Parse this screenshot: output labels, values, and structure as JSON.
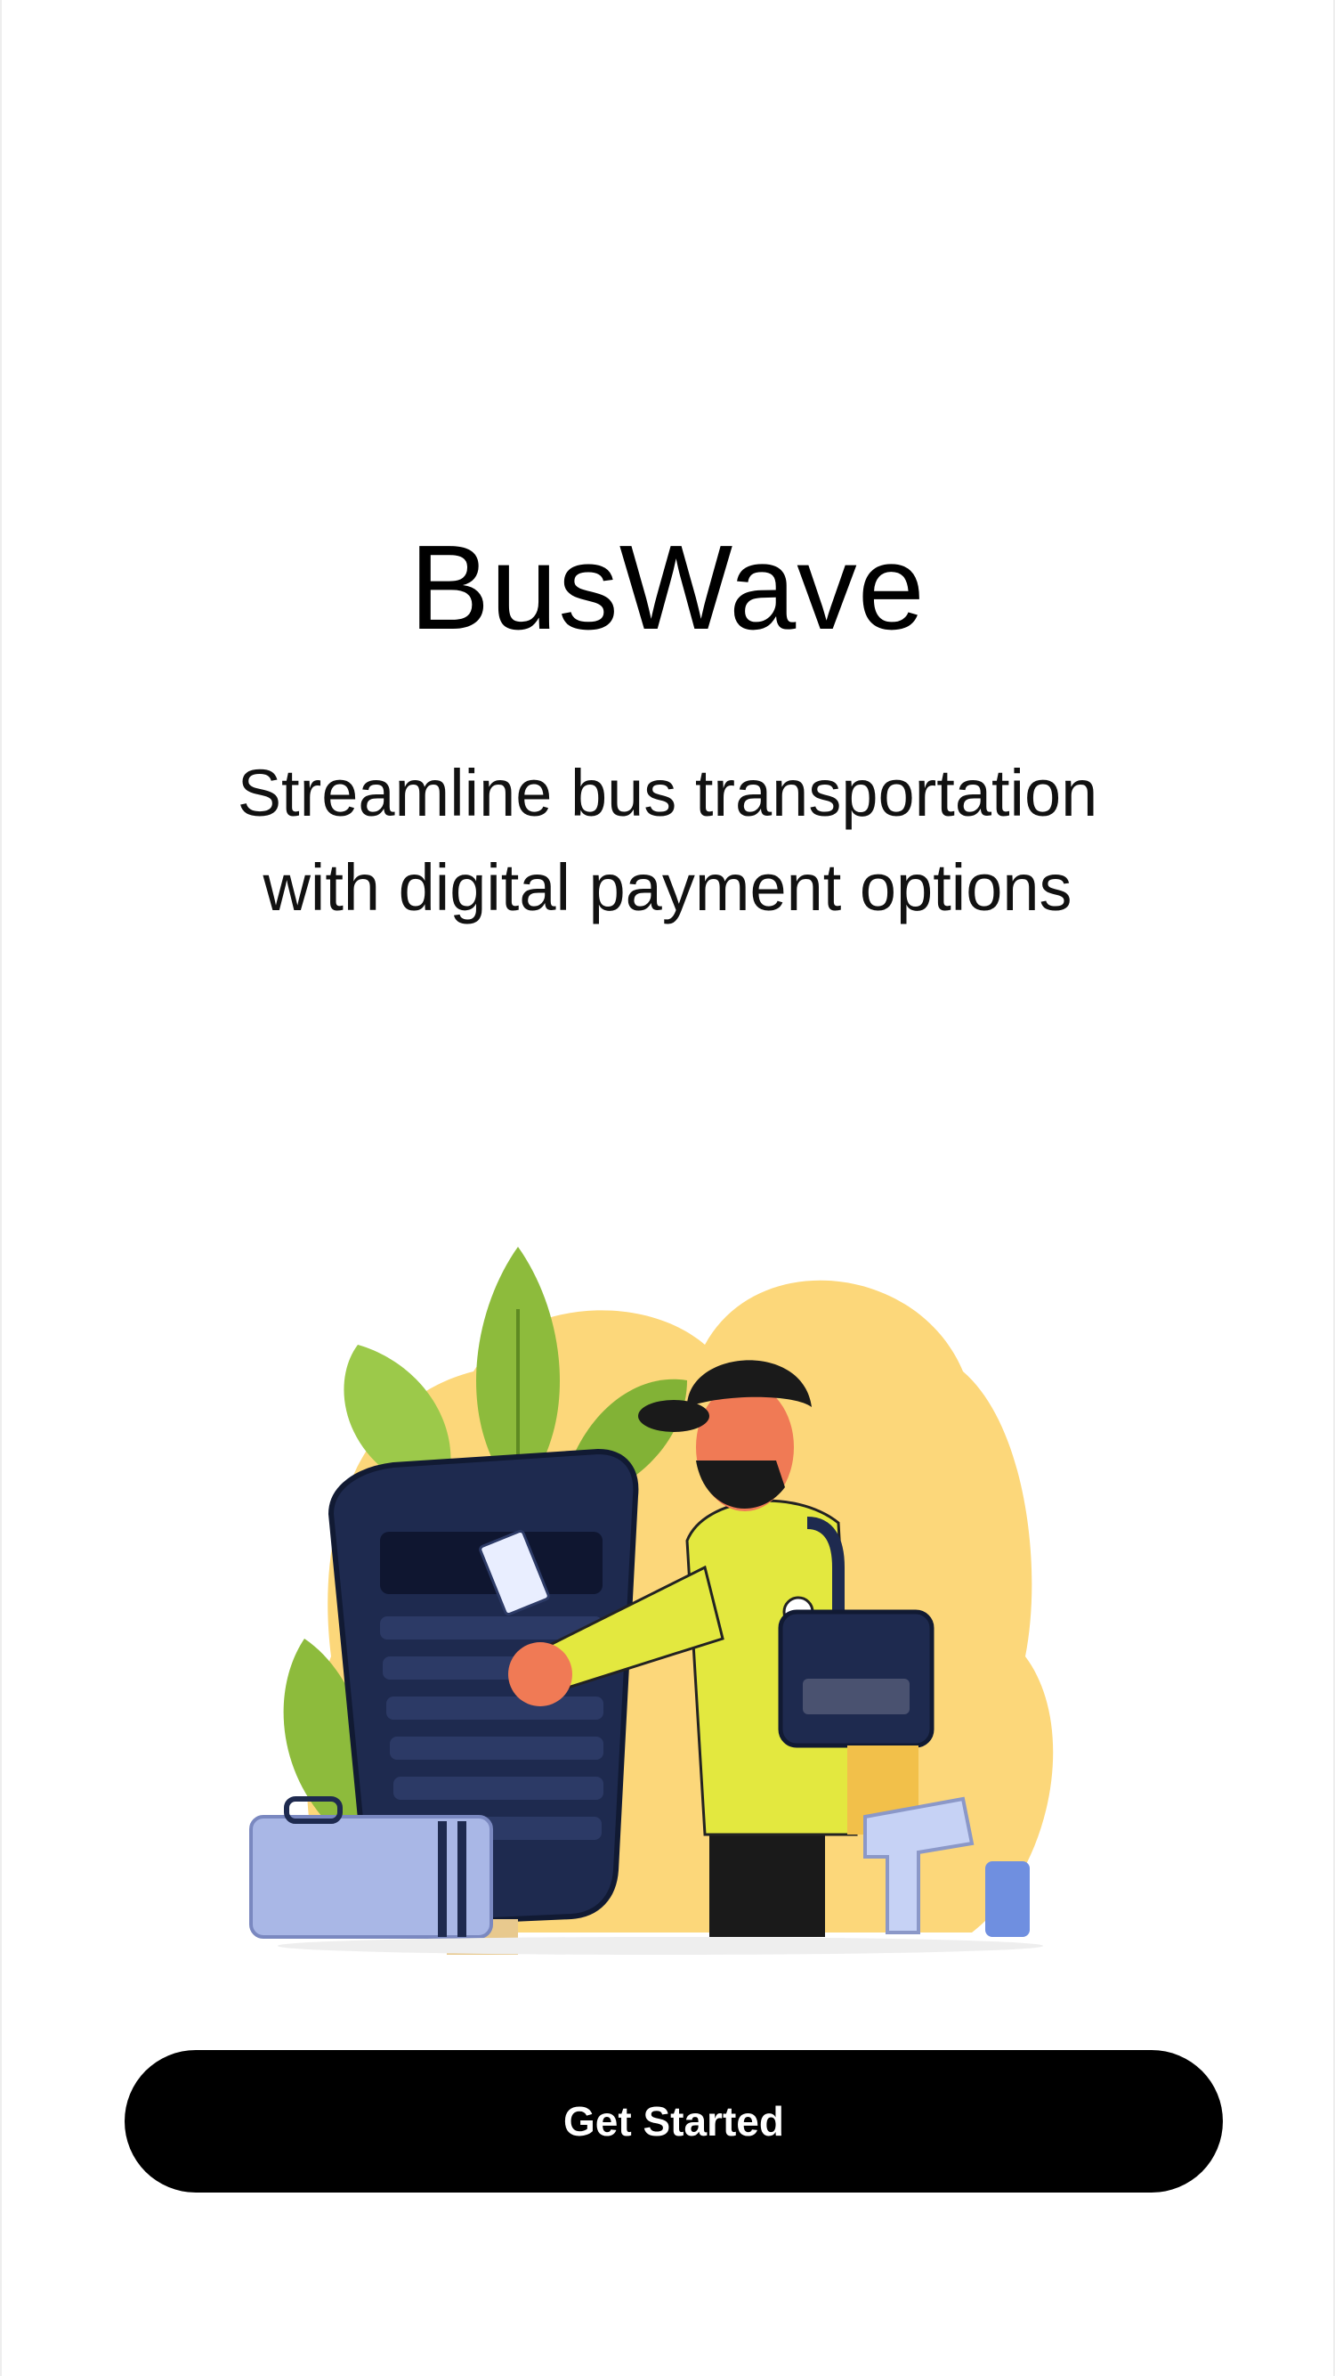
{
  "app": {
    "title": "BusWave",
    "tagline_line1": "Streamline bus transportation",
    "tagline_line2": "with digital payment options"
  },
  "illustration": {
    "icon": "bus-fare-payment-illustration",
    "colors": {
      "background_blob": "#FCD77A",
      "terminal": "#1E2A4F",
      "shirt": "#E3E83F",
      "skin": "#F07A55",
      "leaves": "#8DBB3C",
      "luggage": "#A9B7E6"
    }
  },
  "actions": {
    "get_started_label": "Get Started"
  },
  "theme": {
    "background": "#FFFFFF",
    "button_bg": "#000000",
    "button_text": "#FFFFFF"
  }
}
